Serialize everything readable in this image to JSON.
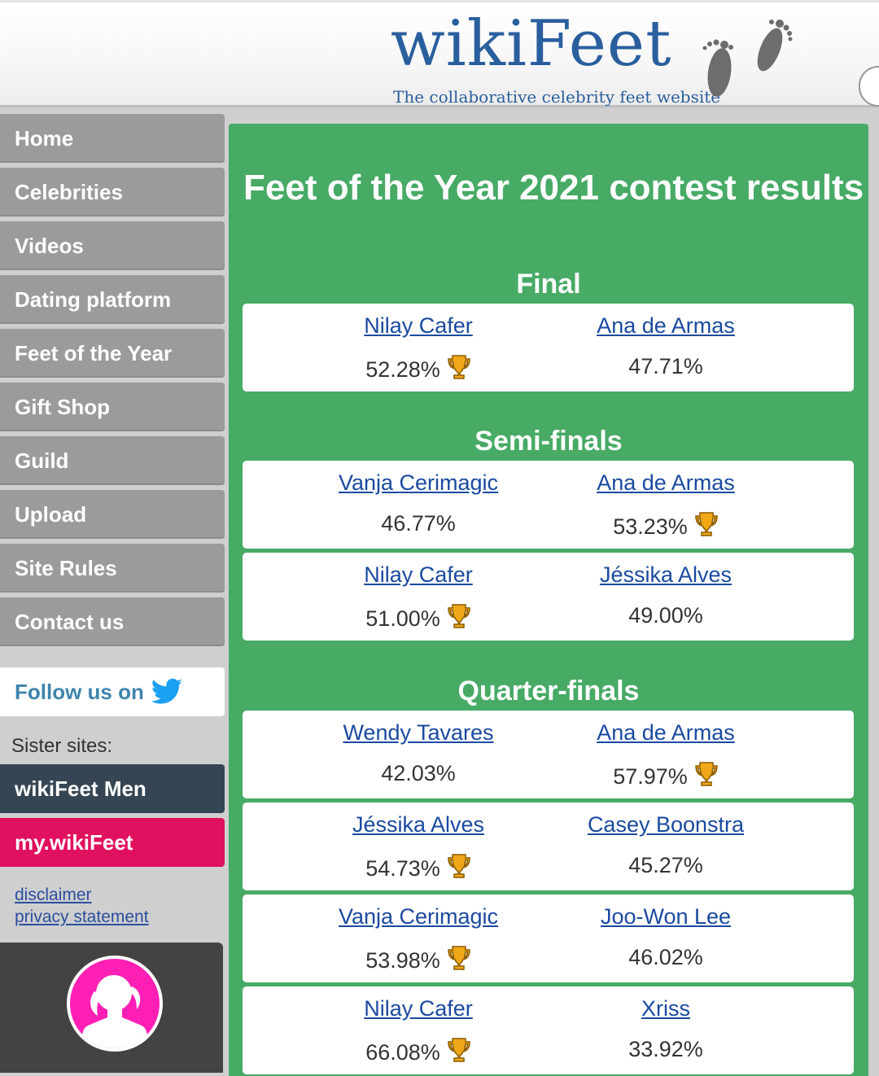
{
  "header": {
    "logo_text": "wikiFeet",
    "tagline": "The collaborative celebrity feet website"
  },
  "nav": {
    "items": [
      {
        "label": "Home"
      },
      {
        "label": "Celebrities"
      },
      {
        "label": "Videos"
      },
      {
        "label": "Dating platform"
      },
      {
        "label": "Feet of the Year"
      },
      {
        "label": "Gift Shop"
      },
      {
        "label": "Guild"
      },
      {
        "label": "Upload"
      },
      {
        "label": "Site Rules"
      },
      {
        "label": "Contact us"
      }
    ],
    "follow_label": "Follow us on",
    "sister_label": "Sister sites:",
    "sister_men": "wikiFeet Men",
    "sister_my": "my.wikiFeet",
    "disclaimer": "disclaimer",
    "privacy": "privacy statement"
  },
  "main": {
    "title": "Feet of the Year 2021 contest results",
    "rounds": {
      "final": {
        "title": "Final",
        "matches": [
          {
            "left": {
              "name": "Nilay Cafer",
              "pct": "52.28%",
              "winner": true
            },
            "right": {
              "name": "Ana de Armas",
              "pct": "47.71%",
              "winner": false
            }
          }
        ]
      },
      "semi": {
        "title": "Semi-finals",
        "matches": [
          {
            "left": {
              "name": "Vanja Cerimagic",
              "pct": "46.77%",
              "winner": false
            },
            "right": {
              "name": "Ana de Armas",
              "pct": "53.23%",
              "winner": true
            }
          },
          {
            "left": {
              "name": "Nilay Cafer",
              "pct": "51.00%",
              "winner": true
            },
            "right": {
              "name": "Jéssika Alves",
              "pct": "49.00%",
              "winner": false
            }
          }
        ]
      },
      "quarter": {
        "title": "Quarter-finals",
        "matches": [
          {
            "left": {
              "name": "Wendy Tavares",
              "pct": "42.03%",
              "winner": false
            },
            "right": {
              "name": "Ana de Armas",
              "pct": "57.97%",
              "winner": true
            }
          },
          {
            "left": {
              "name": "Jéssika Alves",
              "pct": "54.73%",
              "winner": true
            },
            "right": {
              "name": "Casey Boonstra",
              "pct": "45.27%",
              "winner": false
            }
          },
          {
            "left": {
              "name": "Vanja Cerimagic",
              "pct": "53.98%",
              "winner": true
            },
            "right": {
              "name": "Joo-Won Lee",
              "pct": "46.02%",
              "winner": false
            }
          },
          {
            "left": {
              "name": "Nilay Cafer",
              "pct": "66.08%",
              "winner": true
            },
            "right": {
              "name": "Xriss",
              "pct": "33.92%",
              "winner": false
            }
          }
        ]
      }
    }
  },
  "colors": {
    "panel": "#47aa65",
    "nav": "#9b9b9b",
    "link": "#1a4aa0",
    "sister_men": "#354553",
    "sister_my": "#e0115f"
  }
}
